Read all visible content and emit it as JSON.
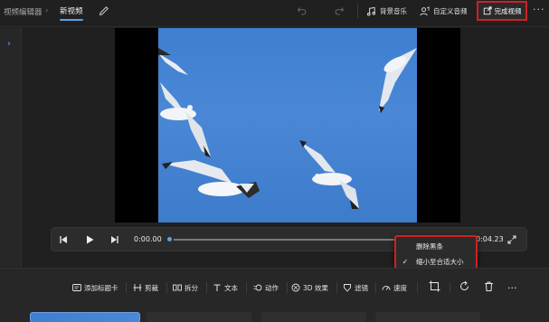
{
  "header": {
    "app_name": "视频编辑器",
    "separator": "›",
    "project_name": "新视频",
    "bgm_label": "背景音乐",
    "custom_audio_label": "自定义音频",
    "finish_label": "完成视频",
    "more_label": "···"
  },
  "player": {
    "current_time": "0:00.00",
    "end_time": "0:04.23",
    "progress": 0
  },
  "context_menu": {
    "items": [
      {
        "label": "删除黑条",
        "checked": false
      },
      {
        "label": "缩小至合适大小",
        "checked": true
      }
    ],
    "check_glyph": "✓"
  },
  "storyboard": {
    "add_title_card": "添加标题卡",
    "trim": "剪裁",
    "split": "拆分",
    "text": "文本",
    "motion": "动作",
    "effects_3d": "3D 效果",
    "filters": "滤镜",
    "speed": "速度",
    "more_label": "···"
  },
  "icons": {
    "edit": "pencil-icon",
    "undo": "undo-icon",
    "redo": "redo-icon",
    "music": "music-note-icon",
    "custom_audio": "audio-person-icon",
    "export": "export-icon",
    "collapse": "chevron-right-icon",
    "prev": "previous-frame-icon",
    "play": "play-icon",
    "next": "next-frame-icon",
    "fullscreen": "expand-icon",
    "resize": "crop-resize-icon",
    "rotate": "rotate-icon",
    "delete": "trash-icon"
  },
  "colors": {
    "accent": "#5aa2e6",
    "highlight_border": "#d12020",
    "sky": "#4a88d6"
  }
}
